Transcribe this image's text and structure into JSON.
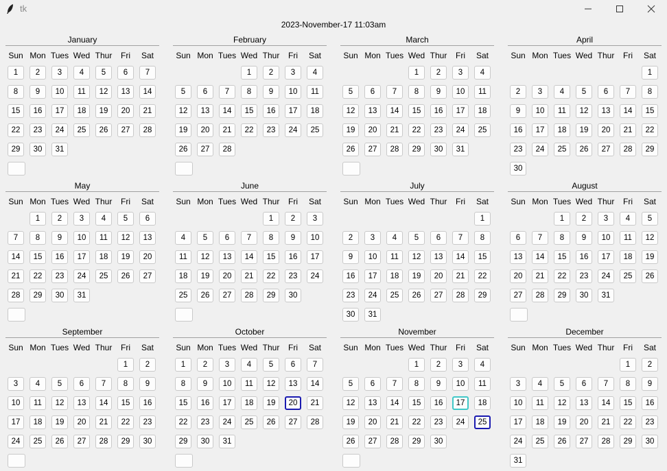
{
  "window": {
    "title": "tk"
  },
  "datetime": "2023-November-17 11:03am",
  "weekday_headers": [
    "Sun",
    "Mon",
    "Tues",
    "Wed",
    "Thur",
    "Fri",
    "Sat"
  ],
  "today": {
    "month": 11,
    "day": 17
  },
  "marked_days": [
    {
      "month": 10,
      "day": 20
    },
    {
      "month": 11,
      "day": 25
    }
  ],
  "colors": {
    "background": "#f0f0f0",
    "today_border": "#40c8c8",
    "marked_border": "#1a1ab0"
  },
  "months": [
    {
      "name": "January",
      "start": 0,
      "days": 31,
      "blank_button": true
    },
    {
      "name": "February",
      "start": 3,
      "days": 28,
      "blank_button": true
    },
    {
      "name": "March",
      "start": 3,
      "days": 31,
      "blank_button": true
    },
    {
      "name": "April",
      "start": 6,
      "days": 30,
      "blank_button": false
    },
    {
      "name": "May",
      "start": 1,
      "days": 31,
      "blank_button": true
    },
    {
      "name": "June",
      "start": 4,
      "days": 30,
      "blank_button": true
    },
    {
      "name": "July",
      "start": 6,
      "days": 31,
      "blank_button": false
    },
    {
      "name": "August",
      "start": 2,
      "days": 31,
      "blank_button": true
    },
    {
      "name": "September",
      "start": 5,
      "days": 30,
      "blank_button": true
    },
    {
      "name": "October",
      "start": 0,
      "days": 31,
      "blank_button": true
    },
    {
      "name": "November",
      "start": 3,
      "days": 30,
      "blank_button": true
    },
    {
      "name": "December",
      "start": 5,
      "days": 31,
      "blank_button": false
    }
  ]
}
